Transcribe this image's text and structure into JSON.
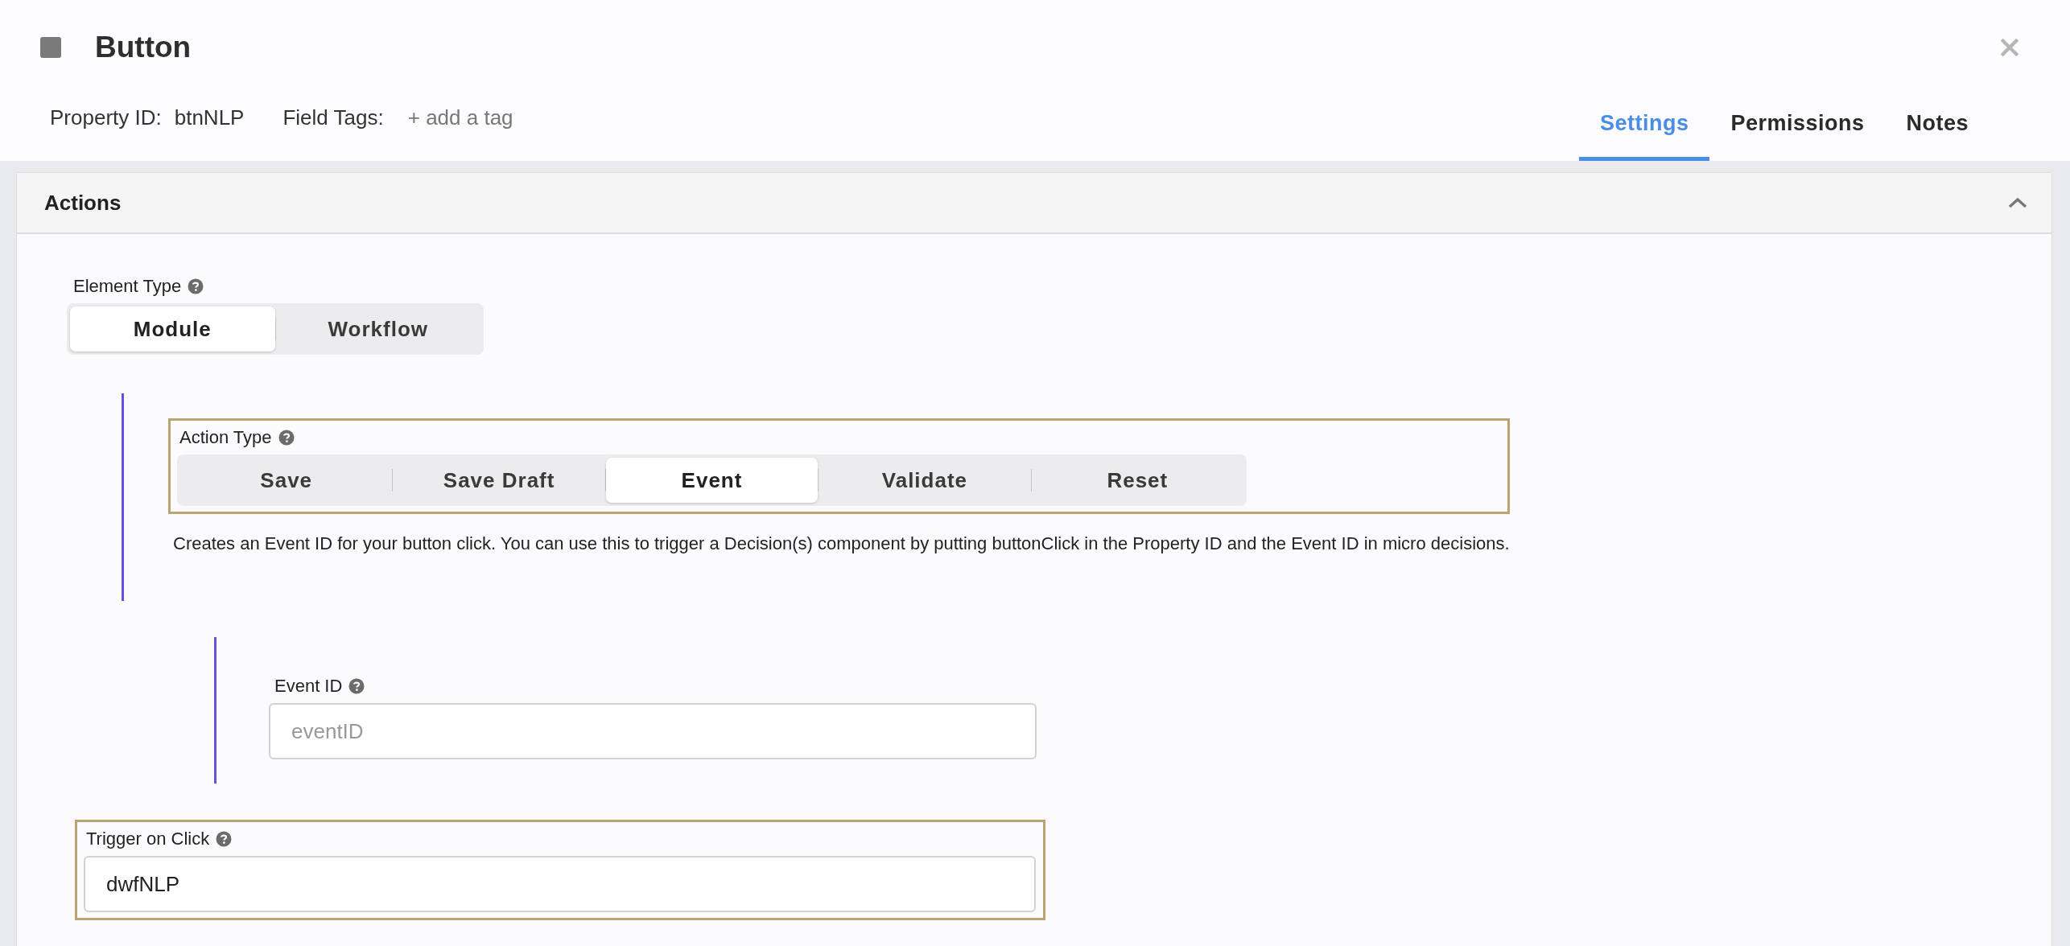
{
  "header": {
    "title": "Button",
    "property_label": "Property ID:",
    "property_value": "btnNLP",
    "tags_label": "Field Tags:",
    "add_tag": "+ add a tag"
  },
  "tabs": [
    {
      "label": "Settings",
      "selected": true
    },
    {
      "label": "Permissions",
      "selected": false
    },
    {
      "label": "Notes",
      "selected": false
    }
  ],
  "panel": {
    "title": "Actions",
    "expanded": true,
    "element_type": {
      "label": "Element Type",
      "options": [
        {
          "label": "Module",
          "selected": true
        },
        {
          "label": "Workflow",
          "selected": false
        }
      ]
    },
    "action_type": {
      "label": "Action Type",
      "options": [
        {
          "label": "Save",
          "selected": false
        },
        {
          "label": "Save Draft",
          "selected": false
        },
        {
          "label": "Event",
          "selected": true
        },
        {
          "label": "Validate",
          "selected": false
        },
        {
          "label": "Reset",
          "selected": false
        }
      ],
      "description": "Creates an Event ID for your button click. You can use this to trigger a Decision(s) component by putting buttonClick in the Property ID and the Event ID in micro decisions."
    },
    "event_id": {
      "label": "Event ID",
      "placeholder": "eventID"
    },
    "trigger": {
      "label": "Trigger on Click",
      "value": "dwfNLP"
    }
  }
}
